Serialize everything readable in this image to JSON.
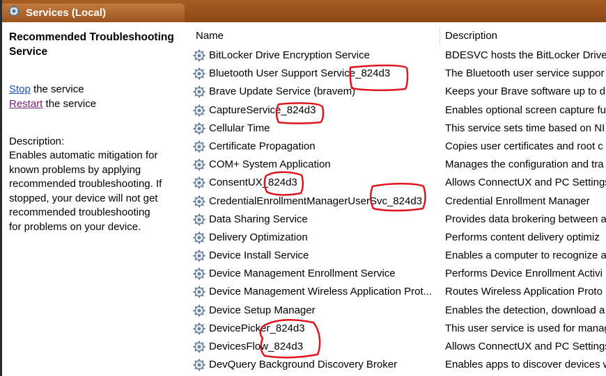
{
  "window": {
    "title": "Services (Local)"
  },
  "left_pane": {
    "service_title": "Recommended Troubleshooting Service",
    "stop_link": "Stop",
    "stop_suffix": " the service",
    "restart_link": "Restart",
    "restart_suffix": " the service",
    "description_label": "Description:",
    "description_text": "Enables automatic mitigation for\nknown problems by applying\nrecommended troubleshooting. If\nstopped, your device will not get\nrecommended troubleshooting\nfor problems on your device."
  },
  "table": {
    "headers": {
      "name": "Name",
      "description": "Description"
    },
    "rows": [
      {
        "name": "BitLocker Drive Encryption Service",
        "description": "BDESVC hosts the BitLocker Drive"
      },
      {
        "name": "Bluetooth User Support Service_824d3",
        "description": "The Bluetooth user service suppor"
      },
      {
        "name": "Brave Update Service (bravem)",
        "description": "Keeps your Brave software up to d"
      },
      {
        "name": "CaptureService_824d3",
        "description": "Enables optional screen capture fu"
      },
      {
        "name": "Cellular Time",
        "description": "This service sets time based on NI"
      },
      {
        "name": "Certificate Propagation",
        "description": "Copies user certificates and root c"
      },
      {
        "name": "COM+ System Application",
        "description": "Manages the configuration and tra"
      },
      {
        "name": "ConsentUX_824d3",
        "description": "Allows ConnectUX and PC Settings"
      },
      {
        "name": "CredentialEnrollmentManagerUserSvc_824d3",
        "description": "Credential Enrollment Manager"
      },
      {
        "name": "Data Sharing Service",
        "description": "Provides data brokering between a"
      },
      {
        "name": "Delivery Optimization",
        "description": "Performs content delivery optimiz"
      },
      {
        "name": "Device Install Service",
        "description": "Enables a computer to recognize a"
      },
      {
        "name": "Device Management Enrollment Service",
        "description": "Performs Device Enrollment Activi"
      },
      {
        "name": "Device Management Wireless Application Prot...",
        "description": "Routes Wireless Application Proto"
      },
      {
        "name": "Device Setup Manager",
        "description": "Enables the detection, download a"
      },
      {
        "name": "DevicePicker_824d3",
        "description": "This user service is used for manag"
      },
      {
        "name": "DevicesFlow_824d3",
        "description": "Allows ConnectUX and PC Settings"
      },
      {
        "name": "DevQuery Background Discovery Broker",
        "description": "Enables apps to discover devices w"
      }
    ]
  },
  "icons": {
    "title": "gear-icon",
    "row": "service-gear-icon"
  },
  "colors": {
    "titlebar": "#9c551f",
    "link": "#1d4fb8",
    "annotation": "#e0141e"
  }
}
